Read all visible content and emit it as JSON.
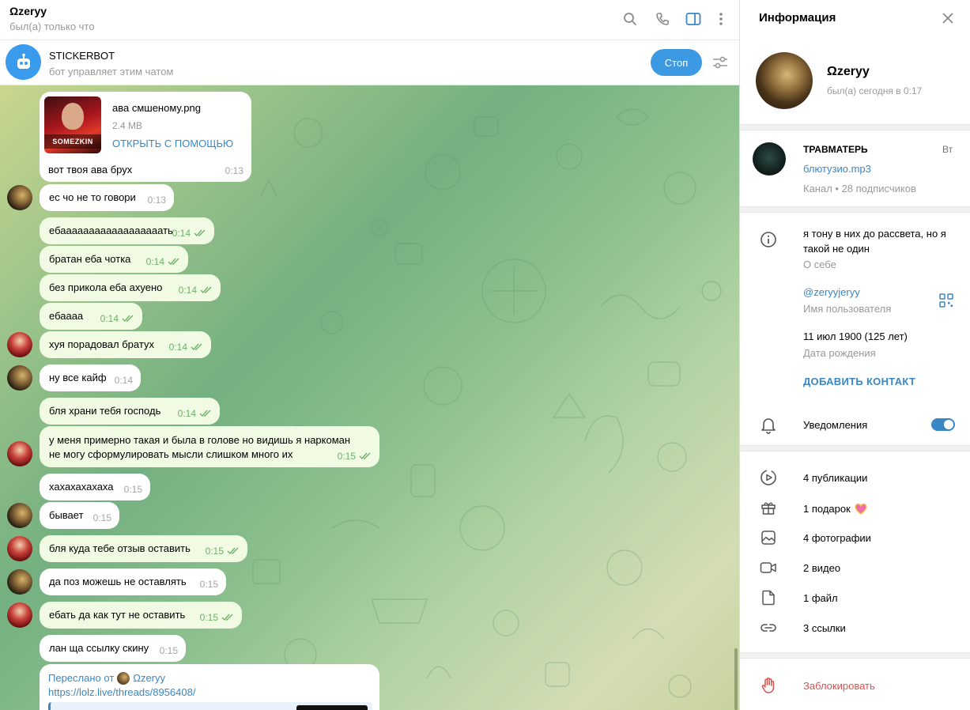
{
  "header": {
    "name": "Ωzeryy",
    "status": "был(а) только что",
    "icons": [
      "search-icon",
      "phone-icon",
      "sidebar-toggle-icon",
      "more-vertical-icon"
    ]
  },
  "bot": {
    "name": "STICKERBOT",
    "subtitle": "бот управляет этим чатом",
    "stop_label": "Стоп"
  },
  "file_message": {
    "thumb_text": "SOMEZKIN",
    "file_name": "ава смшеному.png",
    "file_size": "2.4 MB",
    "open_with": "ОТКРЫТЬ С ПОМОЩЬЮ",
    "text": "вот твоя ава брух",
    "time": "0:13"
  },
  "messages": [
    {
      "text": "ес чо не то говори",
      "time": "0:13"
    },
    {
      "text": "ебаааааааааааааааааать",
      "time": "0:14"
    },
    {
      "text": "братан еба чотка",
      "time": "0:14"
    },
    {
      "text": "без прикола еба ахуено",
      "time": "0:14"
    },
    {
      "text": "ебаааа",
      "time": "0:14"
    },
    {
      "text": "хуя порадовал братух",
      "time": "0:14"
    },
    {
      "text": "ну все кайф",
      "time": "0:14"
    },
    {
      "text": "бля храни тебя господь",
      "time": "0:14"
    },
    {
      "text": "у меня примерно такая и была в голове но видишь я наркоман",
      "text2": "не могу сформулировать мысли слишком много их",
      "time": "0:15"
    },
    {
      "text": "хахахахахаха",
      "time": "0:15"
    },
    {
      "text": "бывает",
      "time": "0:15"
    },
    {
      "text": "бля куда тебе отзыв оставить",
      "time": "0:15"
    },
    {
      "text": "да поз можешь не оставлять",
      "time": "0:15"
    },
    {
      "text": "ебать да как тут не оставить",
      "time": "0:15"
    },
    {
      "text": "лан ща ссылку скину",
      "time": "0:15"
    }
  ],
  "forwarded": {
    "prefix": "Переслано от",
    "from": "Ωzeryy",
    "link": "https://lolz.live/threads/8956408/"
  },
  "info": {
    "title": "Информация",
    "name": "Ωzeryy",
    "last_seen": "был(а) сегодня в 0:17",
    "channel": {
      "name": "ТРАВМАТЕРЬ",
      "day": "Вт",
      "last_post": "блютузио.mp3",
      "meta": "Канал • 28 подписчиков"
    },
    "bio": "я тону в них до рассвета, но я такой не один",
    "bio_label": "О себе",
    "username": "@zeryyjeryy",
    "username_label": "Имя пользователя",
    "birthday": "11 июл 1900 (125 лет)",
    "birthday_label": "Дата рождения",
    "add_contact": "ДОБАВИТЬ КОНТАКТ",
    "notifications": "Уведомления",
    "notifications_on": true,
    "stats": {
      "posts": "4 публикации",
      "gifts": "1 подарок",
      "photos": "4 фотографии",
      "videos": "2 видео",
      "files": "1 файл",
      "links": "3 ссылки"
    },
    "block": "Заблокировать"
  },
  "colors": {
    "accent": "#3b87c4",
    "outgoing_bubble": "#f1fbe3",
    "danger": "#d9534f"
  }
}
